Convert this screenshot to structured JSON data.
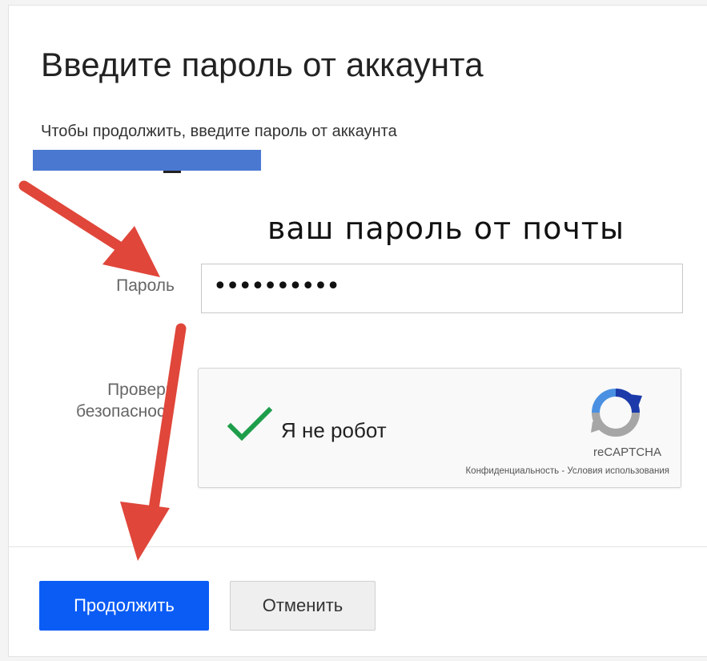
{
  "dialog": {
    "title": "Введите пароль от аккаунта",
    "subtitle": "Чтобы продолжить, введите пароль от аккаунта"
  },
  "annotation": {
    "text": "ваш пароль от почты",
    "arrow_color": "#e0463a"
  },
  "form": {
    "password_label": "Пароль",
    "password_value": "••••••••••",
    "security_label_line1": "Проверк",
    "security_label_line2": "безопасност"
  },
  "captcha": {
    "label": "Я не робот",
    "brand": "reCAPTCHA",
    "links": "Конфиденциальность - Условия использования",
    "checkmark_color": "#1e9e4b"
  },
  "buttons": {
    "continue_label": "Продолжить",
    "cancel_label": "Отменить",
    "primary_color": "#0a5cf5"
  },
  "redaction_color": "#4a78d1",
  "icons": [
    "checkmark-icon",
    "recaptcha-logo-icon",
    "arrow-icon"
  ]
}
